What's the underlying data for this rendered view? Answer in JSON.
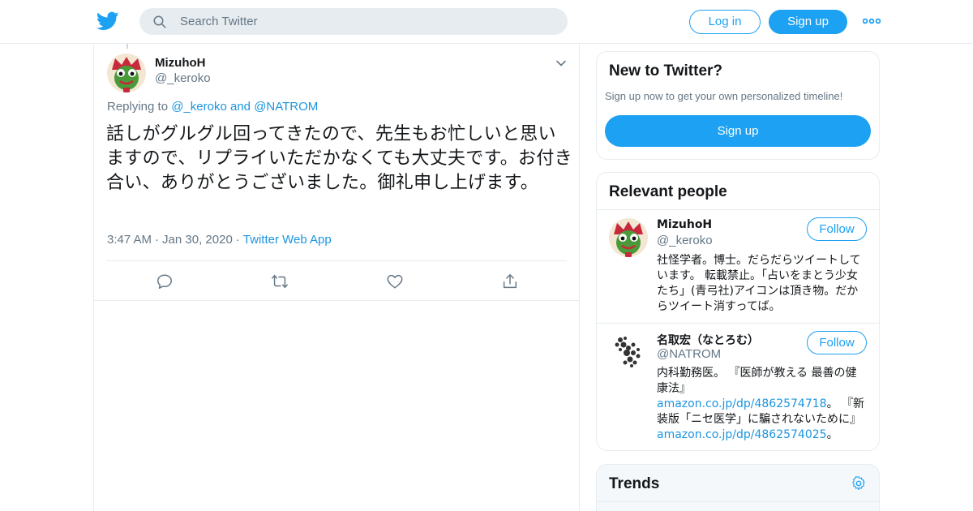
{
  "header": {
    "search_placeholder": "Search Twitter",
    "login_label": "Log in",
    "signup_label": "Sign up"
  },
  "tweet": {
    "display_name": "MizuhoH",
    "handle": "@_keroko",
    "replying_prefix": "Replying to",
    "replying_handle_1": "@_keroko",
    "replying_and": "and",
    "replying_handle_2": "@NATROM",
    "text": "話しがグルグル回ってきたので、先生もお忙しいと思いますので、リプライいただかなくても大丈夫です。お付き合い、ありがとうございました。御礼申し上げます。",
    "time": "3:47 AM",
    "date": "Jan 30, 2020",
    "source": "Twitter Web App"
  },
  "sidebar": {
    "new_card": {
      "title": "New to Twitter?",
      "subtitle": "Sign up now to get your own personalized timeline!",
      "signup_label": "Sign up"
    },
    "relevant_people": {
      "title": "Relevant people",
      "people": [
        {
          "name": "MizuhoH",
          "handle": "@_keroko",
          "bio": "社怪学者。博士。だらだらツイートしています。 転載禁止。「占いをまとう少女たち」(青弓社)アイコンは頂き物。だからツイート消すってば。",
          "follow_label": "Follow"
        },
        {
          "name": "名取宏（なとろむ）",
          "handle": "@NATROM",
          "bio_prefix": "内科勤務医。 『医師が教える 最善の健康法』",
          "bio_link_1": "amazon.co.jp/dp/4862574718",
          "bio_middle": "。 『新装版「ニセ医学」に騙されないために』",
          "bio_link_2": "amazon.co.jp/dp/4862574025",
          "bio_suffix": "。",
          "follow_label": "Follow"
        }
      ]
    },
    "trends": {
      "title": "Trends"
    }
  },
  "colors": {
    "accent": "#1da1f2",
    "link": "#1b95e0",
    "secondary_text": "#657786",
    "border": "#e6ecf0"
  }
}
